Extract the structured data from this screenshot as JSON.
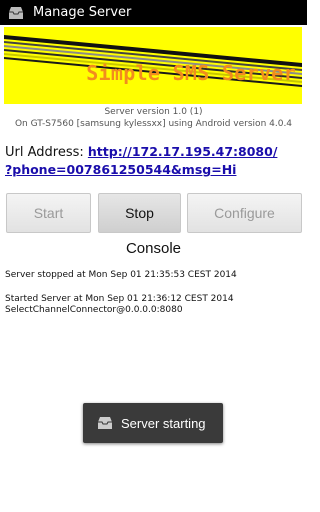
{
  "titlebar": {
    "title": "Manage Server",
    "icon": "inbox-icon"
  },
  "banner": {
    "title": "Simple SMS Server"
  },
  "version": {
    "line1": "Server version 1.0 (1)",
    "line2": "On GT-S7560 [samsung kylessxx] using Android version 4.0.4"
  },
  "url": {
    "label": "Url Address: ",
    "line1": "http://172.17.195.47:8080/",
    "line2": "?phone=007861250544&msg=Hi"
  },
  "buttons": {
    "start": "Start",
    "stop": "Stop",
    "configure": "Configure"
  },
  "console": {
    "title": "Console",
    "lines": [
      "Server stopped at Mon Sep 01 21:35:53 CEST 2014",
      "Started Server at Mon Sep 01 21:36:12 CEST 2014",
      "SelectChannelConnector@0.0.0.0:8080"
    ]
  },
  "toast": {
    "text": "Server starting",
    "icon": "inbox-icon"
  },
  "colors": {
    "banner": "#ffff00",
    "banner_text": "#f28c1e",
    "link": "#1a0dab"
  }
}
